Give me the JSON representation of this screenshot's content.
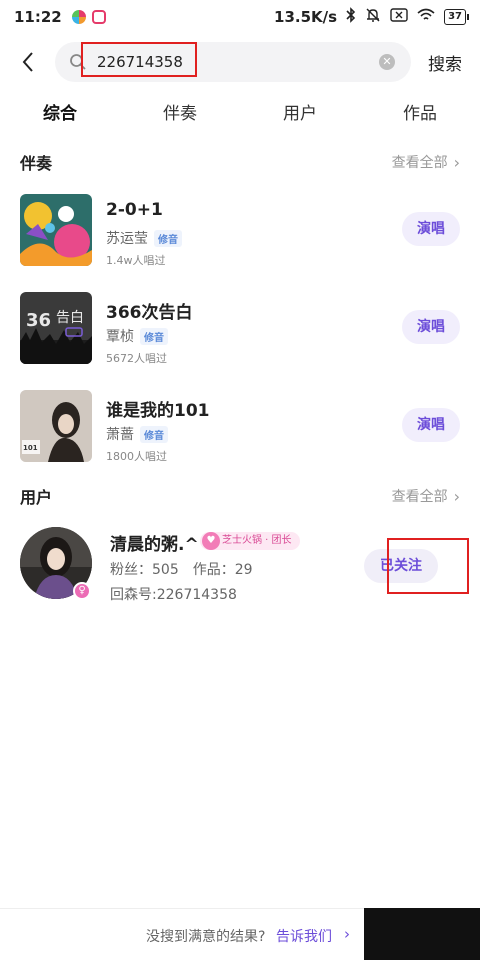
{
  "status_bar": {
    "time": "11:22",
    "network_speed": "13.5K/s",
    "battery": "37",
    "app_colors": [
      "#e53b6a",
      "#f29a2e"
    ]
  },
  "search": {
    "value": "226714358",
    "clear_glyph": "✕",
    "button_label": "搜索",
    "back_glyph": "〈"
  },
  "tabs": [
    {
      "label": "综合"
    },
    {
      "label": "伴奏"
    },
    {
      "label": "用户"
    },
    {
      "label": "作品"
    }
  ],
  "accompaniment_section": {
    "title": "伴奏",
    "view_all": "查看全部",
    "chevron": "›",
    "items": [
      {
        "title": "2-0+1",
        "singer": "苏运莹",
        "tag": "修音",
        "count": "1.4w人唱过",
        "action": "演唱"
      },
      {
        "title": "366次告白",
        "singer": "覃桢",
        "tag": "修音",
        "count": "5672人唱过",
        "action": "演唱"
      },
      {
        "title": "谁是我的101",
        "singer": "萧蔷",
        "tag": "修音",
        "count": "1800人唱过",
        "action": "演唱"
      }
    ]
  },
  "users_section": {
    "title": "用户",
    "view_all": "查看全部",
    "chevron": "›",
    "user": {
      "name": "清晨的粥.^",
      "group_badge": "芝士火锅 · 团长",
      "fans": "粉丝：505",
      "works": "作品：29",
      "id_text": "回森号:226714358",
      "gender_glyph": "♀",
      "follow_label": "已关注"
    }
  },
  "footer": {
    "prompt": "没搜到满意的结果?",
    "link": "告诉我们",
    "chevron": "›"
  },
  "colors": {
    "accent": "#6c4dd9",
    "tab_underline": "#ffd900",
    "highlight": "#e02020"
  }
}
